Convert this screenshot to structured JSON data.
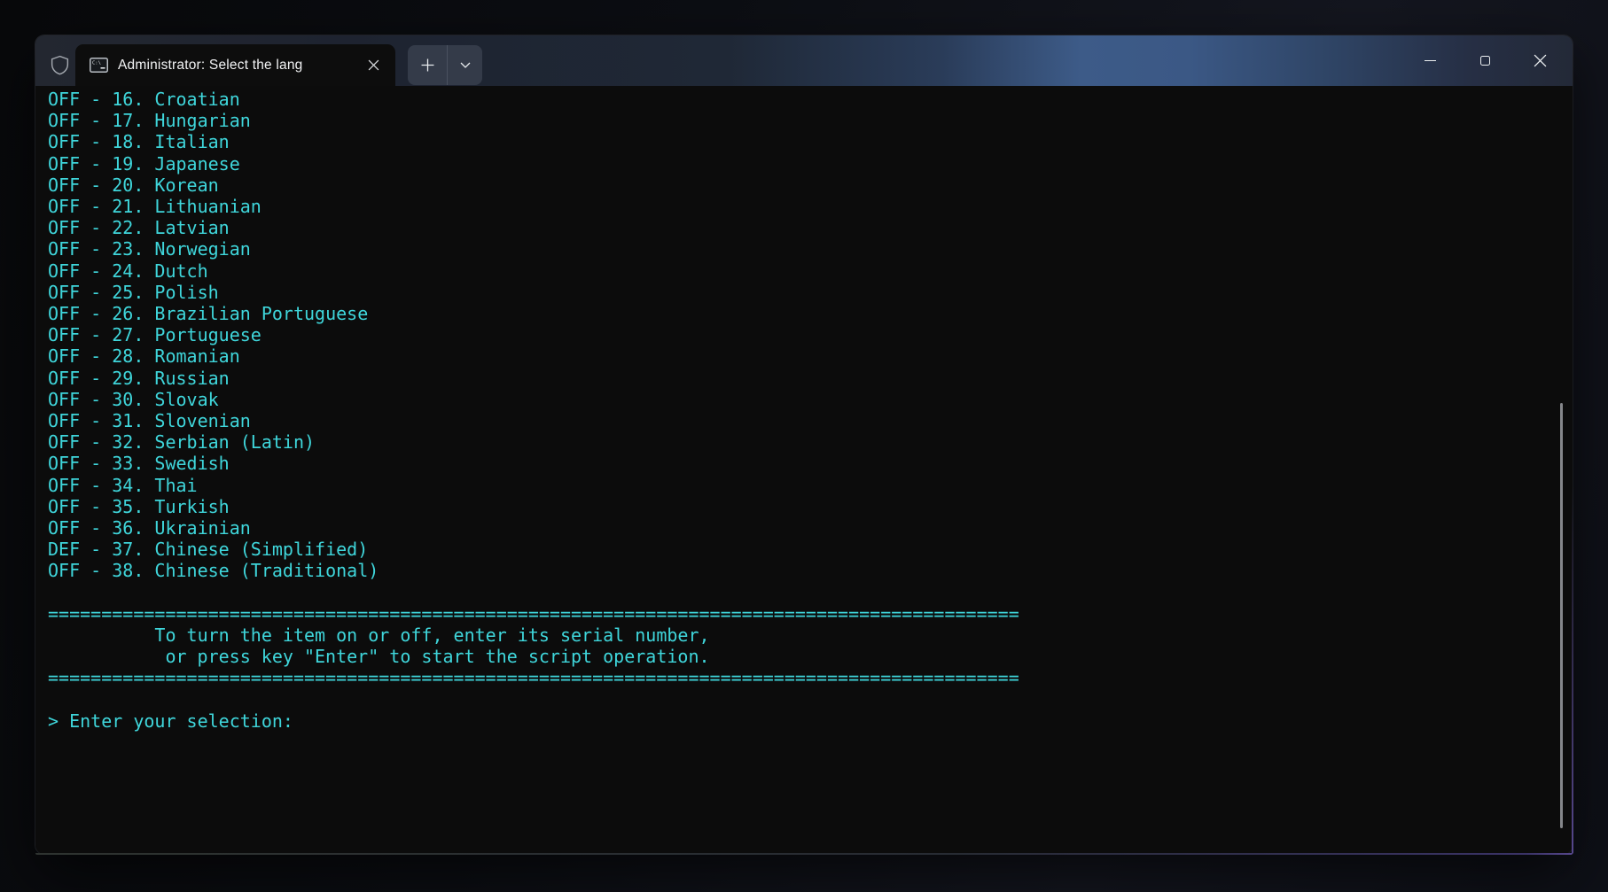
{
  "window": {
    "tab_title": "Administrator:  Select the lang",
    "icons": {
      "titlebar_left": "admin-shield-icon",
      "tab": "command-prompt-icon",
      "tab_close": "close-icon",
      "new_tab": "plus-icon",
      "tab_dropdown": "chevron-down-icon",
      "controls": [
        "minimize-icon",
        "maximize-icon",
        "close-icon"
      ]
    }
  },
  "terminal": {
    "colors": {
      "background": "#0c0c0c",
      "foreground": "#3fd6db"
    },
    "languages": [
      {
        "status": "OFF",
        "number": 16,
        "name": "Croatian"
      },
      {
        "status": "OFF",
        "number": 17,
        "name": "Hungarian"
      },
      {
        "status": "OFF",
        "number": 18,
        "name": "Italian"
      },
      {
        "status": "OFF",
        "number": 19,
        "name": "Japanese"
      },
      {
        "status": "OFF",
        "number": 20,
        "name": "Korean"
      },
      {
        "status": "OFF",
        "number": 21,
        "name": "Lithuanian"
      },
      {
        "status": "OFF",
        "number": 22,
        "name": "Latvian"
      },
      {
        "status": "OFF",
        "number": 23,
        "name": "Norwegian"
      },
      {
        "status": "OFF",
        "number": 24,
        "name": "Dutch"
      },
      {
        "status": "OFF",
        "number": 25,
        "name": "Polish"
      },
      {
        "status": "OFF",
        "number": 26,
        "name": "Brazilian Portuguese"
      },
      {
        "status": "OFF",
        "number": 27,
        "name": "Portuguese"
      },
      {
        "status": "OFF",
        "number": 28,
        "name": "Romanian"
      },
      {
        "status": "OFF",
        "number": 29,
        "name": "Russian"
      },
      {
        "status": "OFF",
        "number": 30,
        "name": "Slovak"
      },
      {
        "status": "OFF",
        "number": 31,
        "name": "Slovenian"
      },
      {
        "status": "OFF",
        "number": 32,
        "name": "Serbian (Latin)"
      },
      {
        "status": "OFF",
        "number": 33,
        "name": "Swedish"
      },
      {
        "status": "OFF",
        "number": 34,
        "name": "Thai"
      },
      {
        "status": "OFF",
        "number": 35,
        "name": "Turkish"
      },
      {
        "status": "OFF",
        "number": 36,
        "name": "Ukrainian"
      },
      {
        "status": "DEF",
        "number": 37,
        "name": "Chinese (Simplified)"
      },
      {
        "status": "OFF",
        "number": 38,
        "name": "Chinese (Traditional)"
      }
    ],
    "separator": "===========================================================================================",
    "instructions": [
      "To turn the item on or off, enter its serial number,",
      "or press key \"Enter\" to start the script operation."
    ],
    "prompt": "> Enter your selection:"
  }
}
